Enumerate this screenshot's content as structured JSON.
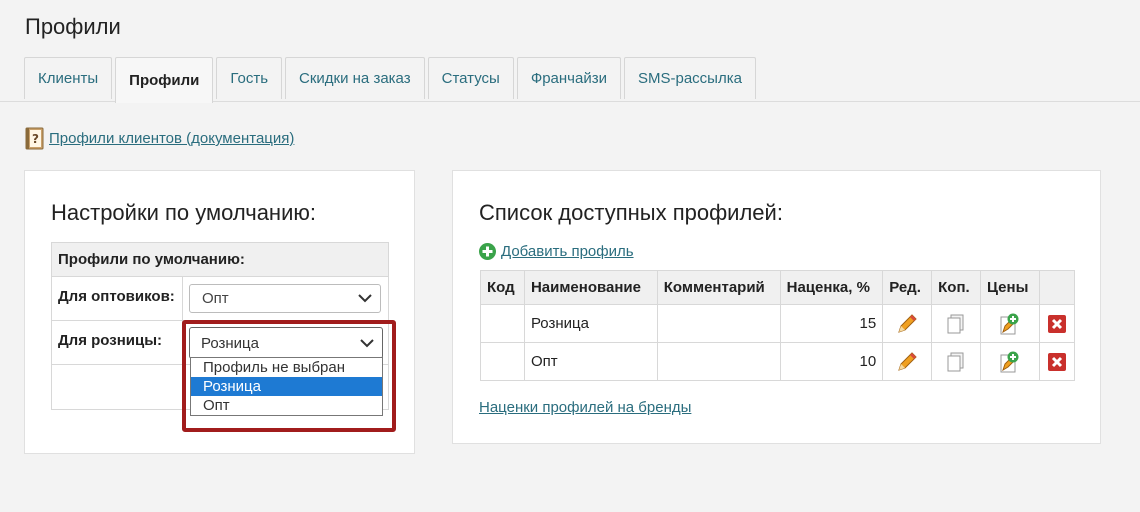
{
  "page": {
    "title": "Профили"
  },
  "tabs": [
    {
      "label": "Клиенты",
      "active": false
    },
    {
      "label": "Профили",
      "active": true
    },
    {
      "label": "Гость",
      "active": false
    },
    {
      "label": "Скидки на заказ",
      "active": false
    },
    {
      "label": "Статусы",
      "active": false
    },
    {
      "label": "Франчайзи",
      "active": false
    },
    {
      "label": "SMS-рассылка",
      "active": false
    }
  ],
  "doc_link": {
    "icon": "book-icon",
    "label": "Профили клиентов (документация)"
  },
  "defaults": {
    "heading": "Настройки по умолчанию:",
    "table_header": "Профили по умолчанию:",
    "wholesale": {
      "label": "Для оптовиков:",
      "value": "Опт"
    },
    "retail": {
      "label": "Для розницы:",
      "value": "Розница",
      "options": [
        "Профиль не выбран",
        "Розница",
        "Опт"
      ],
      "selected_index": 1
    }
  },
  "profiles": {
    "heading": "Список доступных профилей:",
    "add_label": "Добавить профиль",
    "columns": [
      "Код",
      "Наименование",
      "Комментарий",
      "Наценка, %",
      "Ред.",
      "Коп.",
      "Цены"
    ],
    "rows": [
      {
        "code": "",
        "name": "Розница",
        "comment": "",
        "markup": "15"
      },
      {
        "code": "",
        "name": "Опт",
        "comment": "",
        "markup": "10"
      }
    ],
    "brands_link": "Наценки профилей на бренды"
  },
  "colors": {
    "link": "#2a6d7e",
    "highlight": "#a11c1c",
    "selected_option": "#1e7ad3",
    "delete": "#c9302c",
    "add": "#3aa34a"
  }
}
